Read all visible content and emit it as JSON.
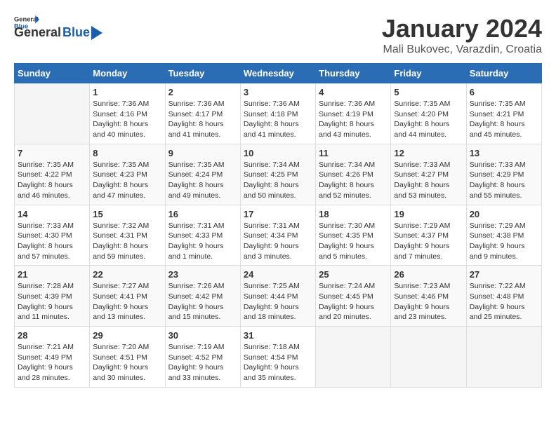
{
  "header": {
    "logo_general": "General",
    "logo_blue": "Blue",
    "month_title": "January 2024",
    "location": "Mali Bukovec, Varazdin, Croatia"
  },
  "days_of_week": [
    "Sunday",
    "Monday",
    "Tuesday",
    "Wednesday",
    "Thursday",
    "Friday",
    "Saturday"
  ],
  "weeks": [
    [
      {
        "day": "",
        "sunrise": "",
        "sunset": "",
        "daylight": "",
        "empty": true
      },
      {
        "day": "1",
        "sunrise": "Sunrise: 7:36 AM",
        "sunset": "Sunset: 4:16 PM",
        "daylight": "Daylight: 8 hours and 40 minutes."
      },
      {
        "day": "2",
        "sunrise": "Sunrise: 7:36 AM",
        "sunset": "Sunset: 4:17 PM",
        "daylight": "Daylight: 8 hours and 41 minutes."
      },
      {
        "day": "3",
        "sunrise": "Sunrise: 7:36 AM",
        "sunset": "Sunset: 4:18 PM",
        "daylight": "Daylight: 8 hours and 41 minutes."
      },
      {
        "day": "4",
        "sunrise": "Sunrise: 7:36 AM",
        "sunset": "Sunset: 4:19 PM",
        "daylight": "Daylight: 8 hours and 43 minutes."
      },
      {
        "day": "5",
        "sunrise": "Sunrise: 7:35 AM",
        "sunset": "Sunset: 4:20 PM",
        "daylight": "Daylight: 8 hours and 44 minutes."
      },
      {
        "day": "6",
        "sunrise": "Sunrise: 7:35 AM",
        "sunset": "Sunset: 4:21 PM",
        "daylight": "Daylight: 8 hours and 45 minutes."
      }
    ],
    [
      {
        "day": "7",
        "sunrise": "Sunrise: 7:35 AM",
        "sunset": "Sunset: 4:22 PM",
        "daylight": "Daylight: 8 hours and 46 minutes."
      },
      {
        "day": "8",
        "sunrise": "Sunrise: 7:35 AM",
        "sunset": "Sunset: 4:23 PM",
        "daylight": "Daylight: 8 hours and 47 minutes."
      },
      {
        "day": "9",
        "sunrise": "Sunrise: 7:35 AM",
        "sunset": "Sunset: 4:24 PM",
        "daylight": "Daylight: 8 hours and 49 minutes."
      },
      {
        "day": "10",
        "sunrise": "Sunrise: 7:34 AM",
        "sunset": "Sunset: 4:25 PM",
        "daylight": "Daylight: 8 hours and 50 minutes."
      },
      {
        "day": "11",
        "sunrise": "Sunrise: 7:34 AM",
        "sunset": "Sunset: 4:26 PM",
        "daylight": "Daylight: 8 hours and 52 minutes."
      },
      {
        "day": "12",
        "sunrise": "Sunrise: 7:33 AM",
        "sunset": "Sunset: 4:27 PM",
        "daylight": "Daylight: 8 hours and 53 minutes."
      },
      {
        "day": "13",
        "sunrise": "Sunrise: 7:33 AM",
        "sunset": "Sunset: 4:29 PM",
        "daylight": "Daylight: 8 hours and 55 minutes."
      }
    ],
    [
      {
        "day": "14",
        "sunrise": "Sunrise: 7:33 AM",
        "sunset": "Sunset: 4:30 PM",
        "daylight": "Daylight: 8 hours and 57 minutes."
      },
      {
        "day": "15",
        "sunrise": "Sunrise: 7:32 AM",
        "sunset": "Sunset: 4:31 PM",
        "daylight": "Daylight: 8 hours and 59 minutes."
      },
      {
        "day": "16",
        "sunrise": "Sunrise: 7:31 AM",
        "sunset": "Sunset: 4:33 PM",
        "daylight": "Daylight: 9 hours and 1 minute."
      },
      {
        "day": "17",
        "sunrise": "Sunrise: 7:31 AM",
        "sunset": "Sunset: 4:34 PM",
        "daylight": "Daylight: 9 hours and 3 minutes."
      },
      {
        "day": "18",
        "sunrise": "Sunrise: 7:30 AM",
        "sunset": "Sunset: 4:35 PM",
        "daylight": "Daylight: 9 hours and 5 minutes."
      },
      {
        "day": "19",
        "sunrise": "Sunrise: 7:29 AM",
        "sunset": "Sunset: 4:37 PM",
        "daylight": "Daylight: 9 hours and 7 minutes."
      },
      {
        "day": "20",
        "sunrise": "Sunrise: 7:29 AM",
        "sunset": "Sunset: 4:38 PM",
        "daylight": "Daylight: 9 hours and 9 minutes."
      }
    ],
    [
      {
        "day": "21",
        "sunrise": "Sunrise: 7:28 AM",
        "sunset": "Sunset: 4:39 PM",
        "daylight": "Daylight: 9 hours and 11 minutes."
      },
      {
        "day": "22",
        "sunrise": "Sunrise: 7:27 AM",
        "sunset": "Sunset: 4:41 PM",
        "daylight": "Daylight: 9 hours and 13 minutes."
      },
      {
        "day": "23",
        "sunrise": "Sunrise: 7:26 AM",
        "sunset": "Sunset: 4:42 PM",
        "daylight": "Daylight: 9 hours and 15 minutes."
      },
      {
        "day": "24",
        "sunrise": "Sunrise: 7:25 AM",
        "sunset": "Sunset: 4:44 PM",
        "daylight": "Daylight: 9 hours and 18 minutes."
      },
      {
        "day": "25",
        "sunrise": "Sunrise: 7:24 AM",
        "sunset": "Sunset: 4:45 PM",
        "daylight": "Daylight: 9 hours and 20 minutes."
      },
      {
        "day": "26",
        "sunrise": "Sunrise: 7:23 AM",
        "sunset": "Sunset: 4:46 PM",
        "daylight": "Daylight: 9 hours and 23 minutes."
      },
      {
        "day": "27",
        "sunrise": "Sunrise: 7:22 AM",
        "sunset": "Sunset: 4:48 PM",
        "daylight": "Daylight: 9 hours and 25 minutes."
      }
    ],
    [
      {
        "day": "28",
        "sunrise": "Sunrise: 7:21 AM",
        "sunset": "Sunset: 4:49 PM",
        "daylight": "Daylight: 9 hours and 28 minutes."
      },
      {
        "day": "29",
        "sunrise": "Sunrise: 7:20 AM",
        "sunset": "Sunset: 4:51 PM",
        "daylight": "Daylight: 9 hours and 30 minutes."
      },
      {
        "day": "30",
        "sunrise": "Sunrise: 7:19 AM",
        "sunset": "Sunset: 4:52 PM",
        "daylight": "Daylight: 9 hours and 33 minutes."
      },
      {
        "day": "31",
        "sunrise": "Sunrise: 7:18 AM",
        "sunset": "Sunset: 4:54 PM",
        "daylight": "Daylight: 9 hours and 35 minutes."
      },
      {
        "day": "",
        "sunrise": "",
        "sunset": "",
        "daylight": "",
        "empty": true
      },
      {
        "day": "",
        "sunrise": "",
        "sunset": "",
        "daylight": "",
        "empty": true
      },
      {
        "day": "",
        "sunrise": "",
        "sunset": "",
        "daylight": "",
        "empty": true
      }
    ]
  ]
}
